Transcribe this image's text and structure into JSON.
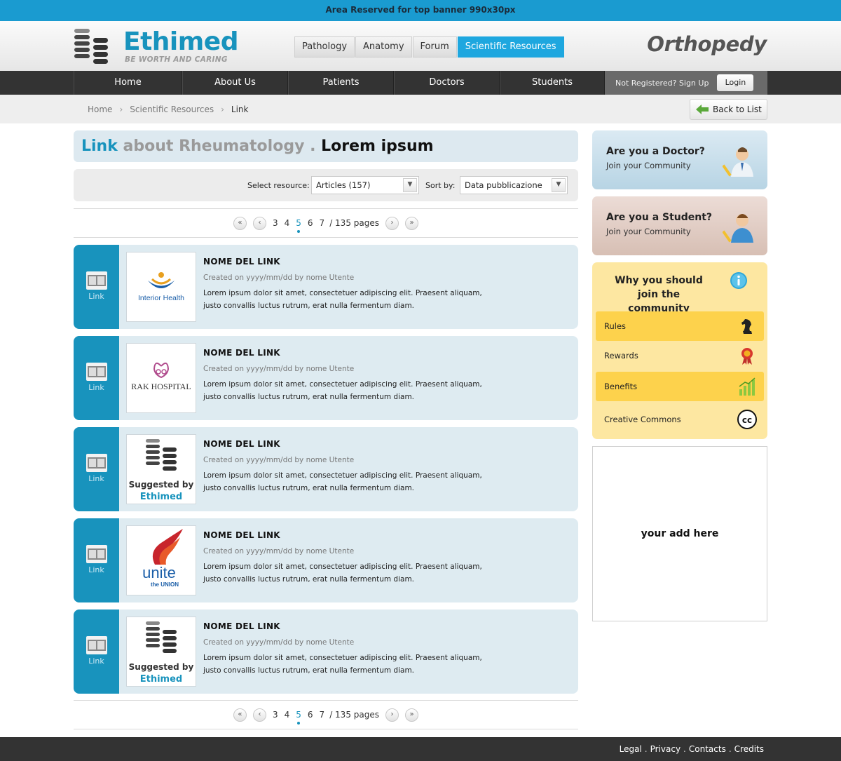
{
  "top_banner": "Area Reserved for top banner 990x30px",
  "header": {
    "logo_name": "Ethimed",
    "logo_tagline": "BE WORTH AND CARING",
    "tabs": [
      "Pathology",
      "Anatomy",
      "Forum",
      "Scientific Resources"
    ],
    "active_tab": "Scientific Resources",
    "site_section": "Orthopedy"
  },
  "nav": {
    "items": [
      "Home",
      "About Us",
      "Patients",
      "Doctors",
      "Students"
    ],
    "signup_text": "Not Registered? Sign Up",
    "login_label": "Login"
  },
  "breadcrumb": {
    "items": [
      "Home",
      "Scientific Resources",
      "Link"
    ],
    "back_label": "Back to List"
  },
  "page_title": {
    "part1": "Link",
    "part2": "about Rheumatology .",
    "part3": "Lorem ipsum"
  },
  "filters": {
    "resource_label": "Select resource:",
    "resource_value": "Articles (157)",
    "sort_label": "Sort by:",
    "sort_value": "Data pubblicazione"
  },
  "pagination": {
    "prev_first": "«",
    "prev": "‹",
    "pages": [
      "3",
      "4",
      "5",
      "6",
      "7"
    ],
    "current": "5",
    "info": "/ 135 pages",
    "next": "›",
    "next_last": "»"
  },
  "items": [
    {
      "type": "Link",
      "logo": "Interior Health",
      "title": "NOME DEL LINK",
      "meta": "Created on yyyy/mm/dd by nome Utente",
      "desc": "Lorem ipsum dolor sit amet, consectetuer adipiscing elit. Praesent aliquam, justo convallis luctus rutrum, erat nulla fermentum diam."
    },
    {
      "type": "Link",
      "logo": "RAK HOSPITAL",
      "title": "NOME DEL LINK",
      "meta": "Created on yyyy/mm/dd by nome Utente",
      "desc": "Lorem ipsum dolor sit amet, consectetuer adipiscing elit. Praesent aliquam, justo convallis luctus rutrum, erat nulla fermentum diam."
    },
    {
      "type": "Link",
      "logo_line1": "Suggested by",
      "logo_line2": "Ethimed",
      "title": "NOME DEL LINK",
      "meta": "Created on yyyy/mm/dd by nome Utente",
      "desc": "Lorem ipsum dolor sit amet, consectetuer adipiscing elit. Praesent aliquam, justo convallis luctus rutrum, erat nulla fermentum diam."
    },
    {
      "type": "Link",
      "logo_line1": "unite",
      "logo_line2": "the UNION",
      "title": "NOME DEL LINK",
      "meta": "Created on yyyy/mm/dd by nome Utente",
      "desc": "Lorem ipsum dolor sit amet, consectetuer adipiscing elit. Praesent aliquam, justo convallis luctus rutrum, erat nulla fermentum diam."
    },
    {
      "type": "Link",
      "logo_line1": "Suggested by",
      "logo_line2": "Ethimed",
      "title": "NOME DEL LINK",
      "meta": "Created on yyyy/mm/dd by nome Utente",
      "desc": "Lorem ipsum dolor sit amet, consectetuer adipiscing elit. Praesent aliquam, justo convallis luctus rutrum, erat nulla fermentum diam."
    }
  ],
  "sidebar": {
    "doctor": {
      "title": "Are you a Doctor?",
      "subtitle": "Join your Community",
      "icon": "doctor-avatar-icon"
    },
    "student": {
      "title": "Are you a Student?",
      "subtitle": "Join your Community",
      "icon": "student-avatar-icon"
    },
    "why": {
      "title": "Why you should join the community",
      "rows": [
        {
          "label": "Rules",
          "icon": "chess-knight-icon"
        },
        {
          "label": "Rewards",
          "icon": "award-ribbon-icon"
        },
        {
          "label": "Benefits",
          "icon": "bar-chart-icon"
        },
        {
          "label": "Creative Commons",
          "icon": "creative-commons-icon"
        }
      ]
    },
    "ad_text": "your add here"
  },
  "footer": {
    "links": [
      "Legal",
      "Privacy",
      "Contacts",
      "Credits"
    ]
  },
  "colors": {
    "accent": "#1893bd",
    "active_tab": "#1ea7df",
    "nav_bg": "#333333",
    "item_bg": "#deebf1",
    "why_bg": "#fde7a1",
    "why_highlight": "#fdd24c"
  }
}
